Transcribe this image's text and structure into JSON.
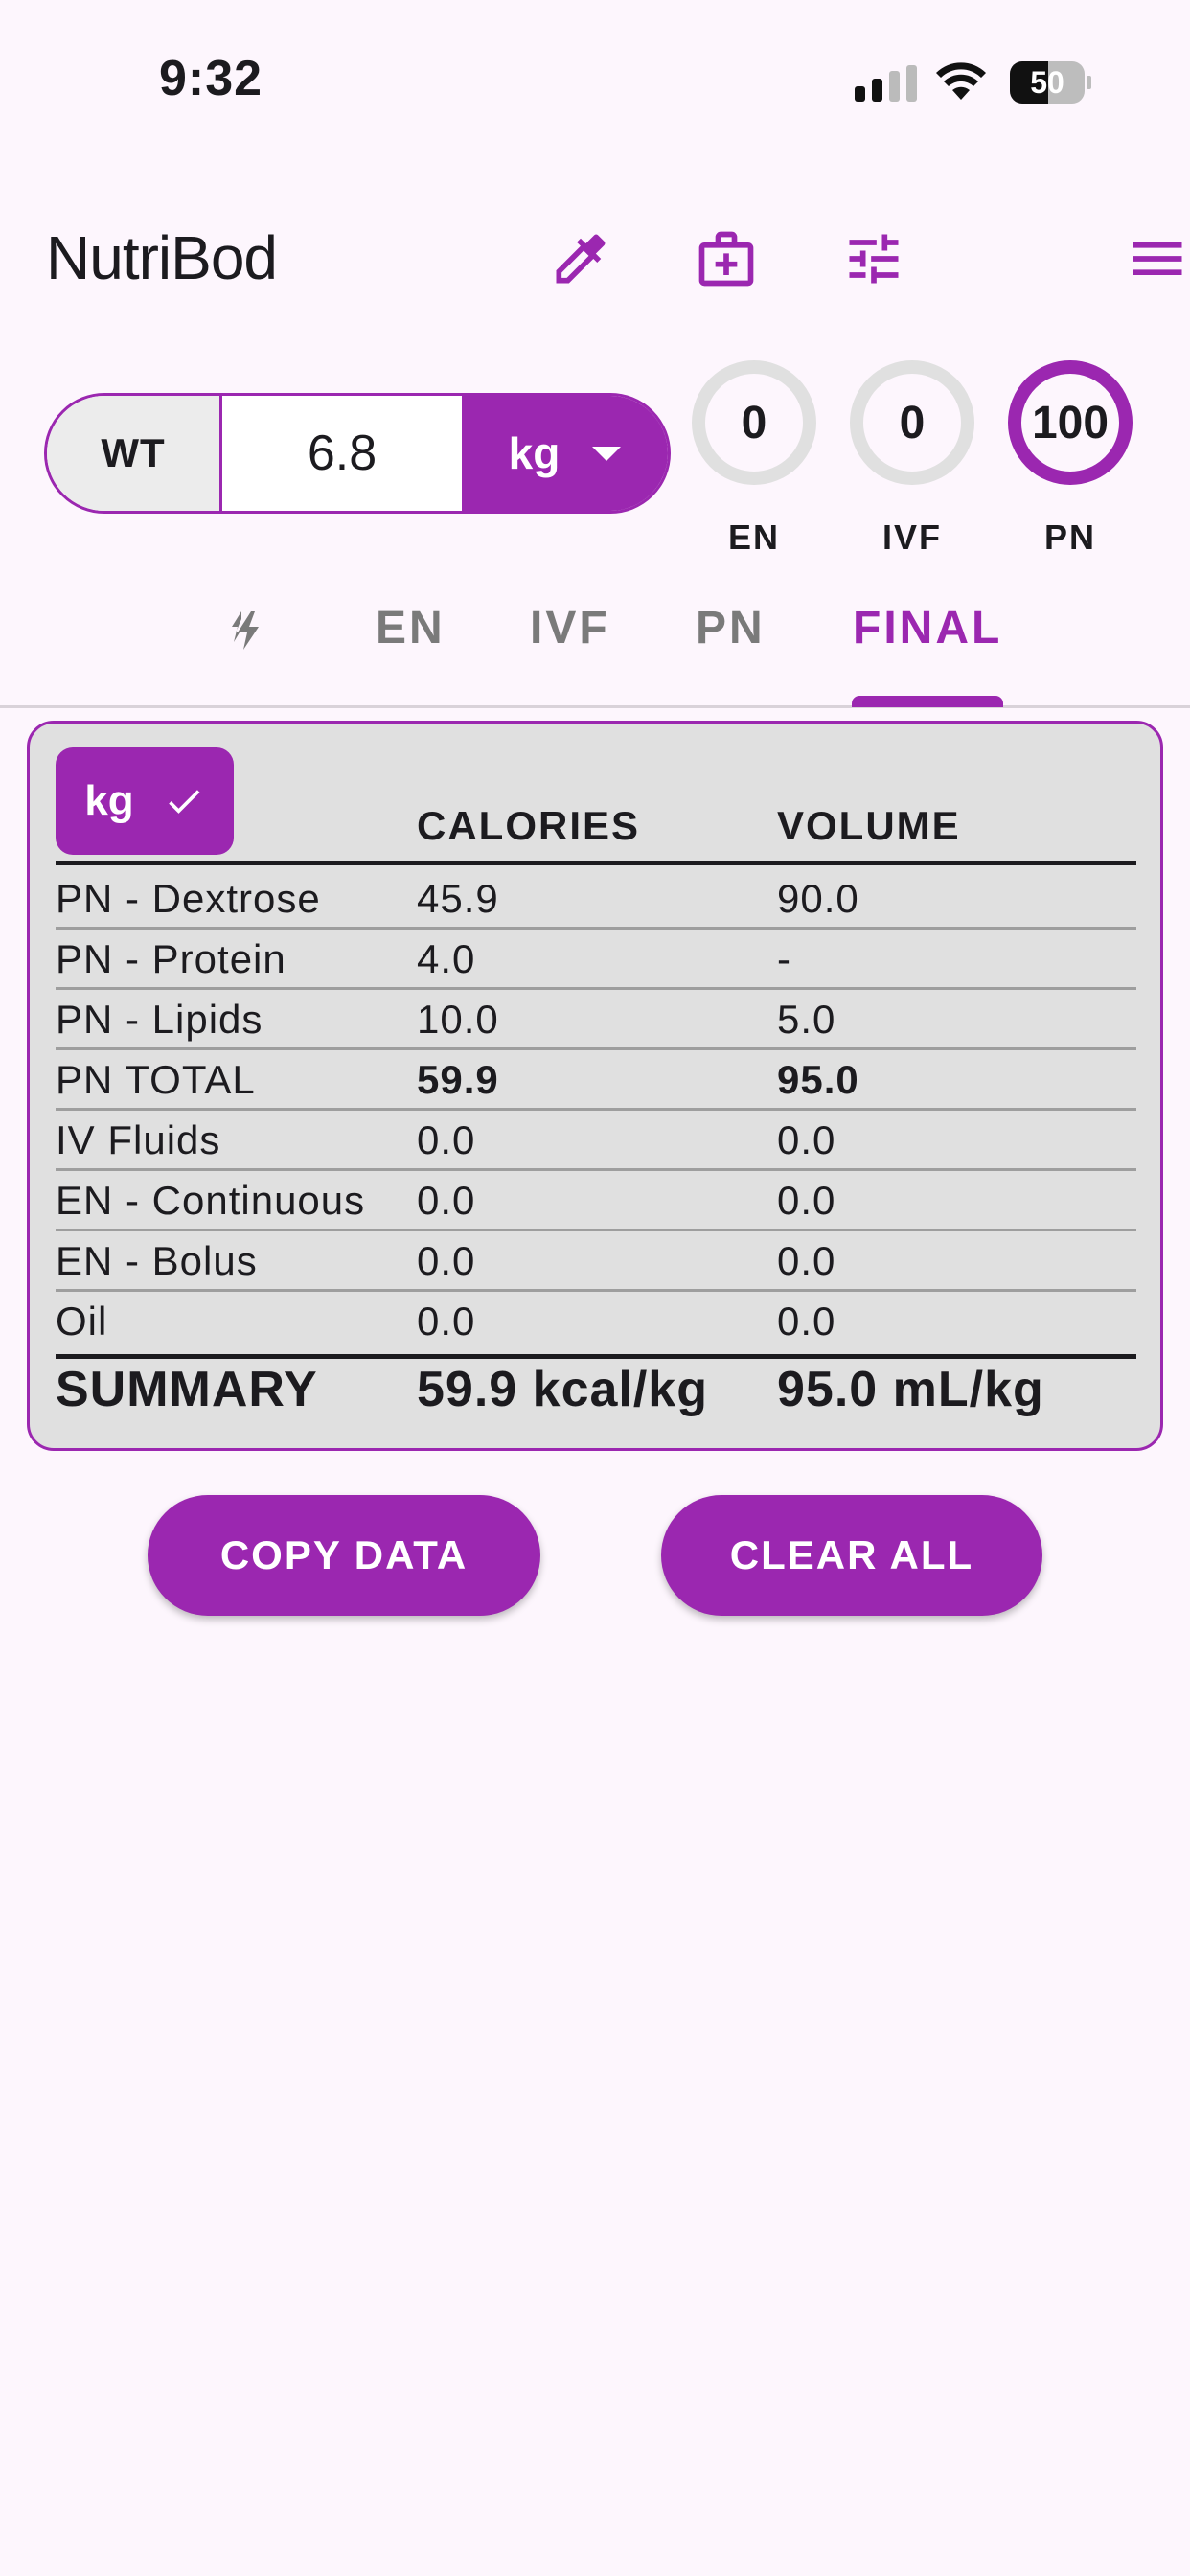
{
  "status_bar": {
    "time": "9:32",
    "battery": "50"
  },
  "header": {
    "title": "NutriBod",
    "icons": [
      "eyedropper-icon",
      "medical-kit-icon",
      "tune-icon",
      "menu-icon"
    ],
    "accent": "#9b27b0"
  },
  "weight": {
    "label": "WT",
    "value": "6.8",
    "unit": "kg"
  },
  "rings": [
    {
      "value": "0",
      "label": "EN"
    },
    {
      "value": "0",
      "label": "IVF"
    },
    {
      "value": "100",
      "label": "PN"
    }
  ],
  "tabs": [
    {
      "label": "",
      "icon": "flash-icon"
    },
    {
      "label": "EN"
    },
    {
      "label": "IVF"
    },
    {
      "label": "PN"
    },
    {
      "label": "FINAL",
      "active": true
    }
  ],
  "table": {
    "unit_chip": "kg",
    "headers": {
      "calories": "CALORIES",
      "volume": "VOLUME"
    },
    "rows": [
      {
        "name": "PN - Dextrose",
        "calories": "45.9",
        "volume": "90.0"
      },
      {
        "name": "PN - Protein",
        "calories": "4.0",
        "volume": "-"
      },
      {
        "name": "PN - Lipids",
        "calories": "10.0",
        "volume": "5.0"
      },
      {
        "name": "PN TOTAL",
        "calories": "59.9",
        "volume": "95.0"
      },
      {
        "name": "IV Fluids",
        "calories": "0.0",
        "volume": "0.0"
      },
      {
        "name": "EN - Continuous",
        "calories": "0.0",
        "volume": "0.0"
      },
      {
        "name": "EN - Bolus",
        "calories": "0.0",
        "volume": "0.0"
      },
      {
        "name": "Oil",
        "calories": "0.0",
        "volume": "0.0"
      }
    ],
    "summary": {
      "label": "SUMMARY",
      "calories": "59.9 kcal/kg",
      "volume": "95.0 mL/kg"
    }
  },
  "buttons": {
    "copy": "COPY DATA",
    "clear": "CLEAR ALL"
  }
}
